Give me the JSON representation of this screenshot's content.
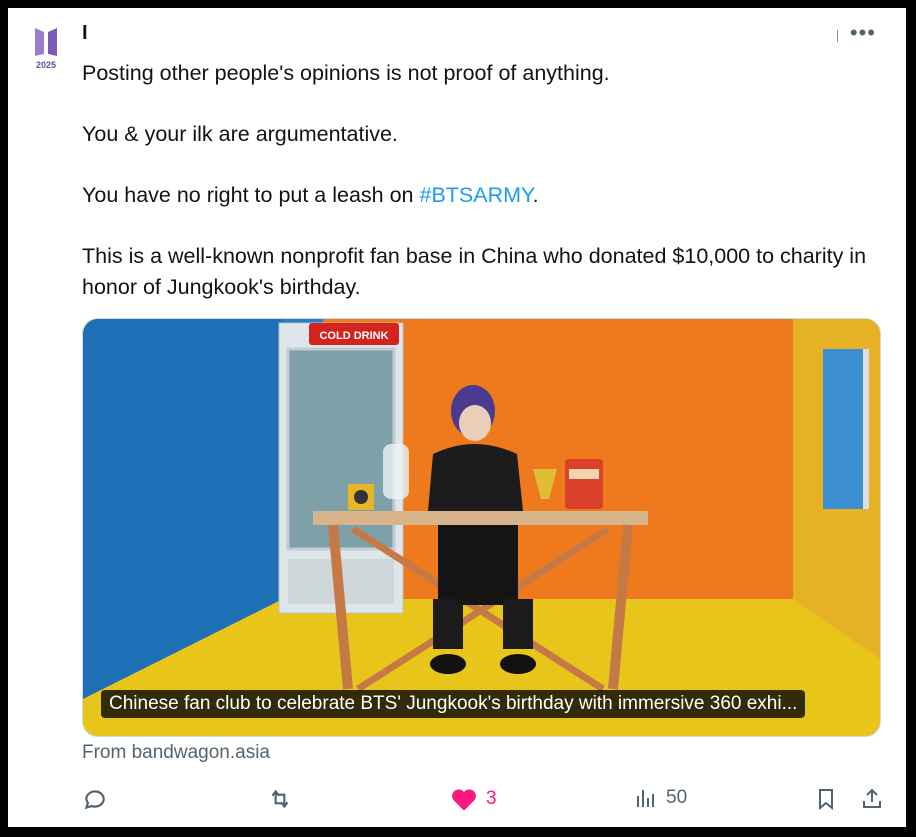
{
  "author": {
    "name": "I",
    "avatar_year": "2025"
  },
  "tweet": {
    "paragraphs": [
      {
        "text": "Posting other people's opinions is not proof of anything."
      },
      {
        "text": "You & your ilk are argumentative."
      },
      {
        "before": "You have no right to put a leash on ",
        "hashtag": "#BTSARMY",
        "after": "."
      },
      {
        "text": "This is a well-known nonprofit fan base in China who donated $10,000 to charity in honor of Jungkook's birthday."
      }
    ]
  },
  "card": {
    "image_sign": "COLD DRINK",
    "title": "Chinese fan club to celebrate BTS' Jungkook's birthday with immersive 360 exhi...",
    "source": "From bandwagon.asia"
  },
  "actions": {
    "likes": "3",
    "views": "50"
  },
  "colors": {
    "hashtag": "#1d9bf0",
    "like": "#f91880",
    "muted": "#536471"
  }
}
